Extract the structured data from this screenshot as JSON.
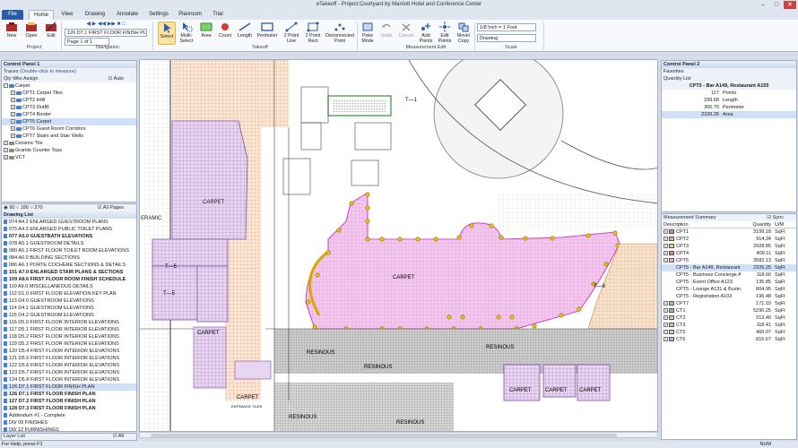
{
  "window": {
    "title": "eTakeoff - Project:Courtyard by Marriott Hotel and Conference Center",
    "minimize": "–",
    "maximize": "□",
    "close": "✕"
  },
  "tabs": [
    "File",
    "Home",
    "View",
    "Drawing",
    "Annotate",
    "Settings",
    "Planroom",
    "Trial"
  ],
  "ribbon": {
    "project_buttons": [
      "New",
      "Open",
      "Edit"
    ],
    "nav_combo": "126 D7.1 FIRST FLOOR FINISH PLAN",
    "page_combo": "Page 1 of 1",
    "takeoff_buttons": [
      "Select",
      "Multi-Select",
      "Area",
      "Count",
      "Length",
      "Perimeter",
      "2 Point Line",
      "2 Point Rect",
      "Disconnected Point"
    ],
    "edit_buttons": [
      "Poke Mode",
      "Undo",
      "Cancel",
      "Add Points",
      "Edit Points",
      "Move/ Copy"
    ],
    "scale_value": "1/8 Inch = 1 Foot",
    "scale_type": "Drawing",
    "group_labels": [
      "Project",
      "Navigation",
      "Takeoff",
      "Measurement Edit",
      "Scale"
    ]
  },
  "left_panel": {
    "title": "Control Panel 1",
    "traces_label": "Traces",
    "traces_hint": "(Double-click to measure)",
    "qty_tab": "Qty Wks Assign",
    "auto_label": "Auto",
    "tree": [
      {
        "label": "Carpet",
        "level": 0,
        "type": "folder",
        "expanded": true
      },
      {
        "label": "CPT1 Carpet Tiles",
        "level": 1,
        "type": "sub"
      },
      {
        "label": "CPT2 Infill",
        "level": 1,
        "type": "sub"
      },
      {
        "label": "CPT3 Outfill",
        "level": 1,
        "type": "sub"
      },
      {
        "label": "CPT4 Border",
        "level": 1,
        "type": "sub"
      },
      {
        "label": "CPT5 Carpet",
        "level": 1,
        "type": "sub",
        "selected": true
      },
      {
        "label": "CPT6 Guest Room Corridors",
        "level": 1,
        "type": "sub"
      },
      {
        "label": "CPT7 Stairs and Stair Wells",
        "level": 1,
        "type": "sub"
      },
      {
        "label": "Ceramic Tile",
        "level": 0,
        "type": "folder-grey"
      },
      {
        "label": "Granite Counter Tops",
        "level": 0,
        "type": "folder-grey"
      },
      {
        "label": "VCT",
        "level": 0,
        "type": "folder-grey"
      }
    ],
    "zoom_options": [
      "90",
      "180",
      "270"
    ],
    "all_pages": "All Pages",
    "drawing_list_title": "Drawing List",
    "drawings": [
      {
        "label": "074 A4.2 ENLARGED GUESTROOM PLANS"
      },
      {
        "label": "075 A4.3 ENLARGED PUBLIC TOILET PLANS"
      },
      {
        "label": "077 A5.0 GUESTBATH ELEVATIONS",
        "bold": true
      },
      {
        "label": "078 A5.1 GUESTROOM DETAILS"
      },
      {
        "label": "080 A5.3 FIRST FLOOR TOILET ROOM ELEVATIONS"
      },
      {
        "label": "084 A6.0 BUILDING SECTIONS"
      },
      {
        "label": "086 A6.1 PORTE COCHERE SECTIONS & DETAILS"
      },
      {
        "label": "101 A7.0 ENLARGED STAIR PLANS & SECTIONS",
        "bold": true
      },
      {
        "label": "109 A8.6 FIRST FLOOR ROOM FINISH SCHEDULE",
        "bold": true
      },
      {
        "label": "110 A9.0 MISCELLANEOUS DETAILS"
      },
      {
        "label": "112 D1.0 FIRST FLOOR ELEVATION KEY PLAN"
      },
      {
        "label": "113 D4.0 GUESTROOM ELEVATIONS"
      },
      {
        "label": "114 D4.1 GUESTROOM ELEVATIONS"
      },
      {
        "label": "115 D4.2 GUESTROOM ELEVATIONS"
      },
      {
        "label": "116 D5.0 FIRST FLOOR INTERIOR ELEVATIONS"
      },
      {
        "label": "117 D5.1 FIRST FLOOR INTERIOR ELEVATIONS"
      },
      {
        "label": "118 D5.2 FIRST FLOOR INTERIOR ELEVATIONS"
      },
      {
        "label": "119 D5.3 FIRST FLOOR INTERIOR ELEVATIONS"
      },
      {
        "label": "120 D5.4 FIRST FLOOR INTERIOR ELEVATIONS"
      },
      {
        "label": "121 D5.5 FIRST FLOOR INTERIOR ELEVATIONS"
      },
      {
        "label": "122 D5.6 FIRST FLOOR INTERIOR ELEVATIONS"
      },
      {
        "label": "123 D5.7 FIRST FLOOR INTERIOR ELEVATIONS"
      },
      {
        "label": "124 D5.8 FIRST FLOOR INTERIOR ELEVATIONS"
      },
      {
        "label": "126 D7.1 FIRST FLOOR FINISH PLAN",
        "selected": true
      },
      {
        "label": "126 D7.1 FIRST FLOOR FINISH PLAN",
        "bold": true
      },
      {
        "label": "127 D7.2 FIRST FLOOR FINISH PLAN",
        "bold": true
      },
      {
        "label": "128 D7.3 FIRST FLOOR FINISH PLAN",
        "bold": true
      },
      {
        "label": "Addendum #1 - Complete"
      },
      {
        "label": "D0/ 09 FINISHES"
      },
      {
        "label": "D0/ 12 FURNISHINGS"
      }
    ],
    "layer_list_title": "Layer List",
    "layer_all": "All"
  },
  "right_panel": {
    "title": "Control Panel 2",
    "favorites_title": "Favorites",
    "quantity_list_title": "Quantity List",
    "selected_item": "CPT5 - Bar A149, Restaurant A155",
    "quantities": [
      {
        "value": "117",
        "label": "Points"
      },
      {
        "value": "299.68",
        "label": "Length"
      },
      {
        "value": "300.70",
        "label": "Perimeter"
      },
      {
        "value": "2326.25",
        "label": "Area",
        "selected": true
      }
    ],
    "summary_title": "Measurement Summary",
    "sync_label": "Sync",
    "summary_headers": [
      "Description",
      "Quantity",
      "U/M"
    ],
    "summary": [
      {
        "desc": "CPT1",
        "qty": "3199.18",
        "um": "SqFt",
        "color": "#b28ad1",
        "level": 0
      },
      {
        "desc": "CPT2",
        "qty": "914.34",
        "um": "SqFt",
        "color": "#f0a58c",
        "level": 0
      },
      {
        "desc": "CPT3",
        "qty": "2928.85",
        "um": "SqFt",
        "color": "#f5c28a",
        "level": 0
      },
      {
        "desc": "CPT4",
        "qty": "409.11",
        "um": "SqFt",
        "color": "#e08080",
        "level": 0
      },
      {
        "desc": "CPT5",
        "qty": "3582.13",
        "um": "SqFt",
        "color": "#f0a8e8",
        "level": 0
      },
      {
        "desc": "CPT5 - Bar A149, Restaurant A155",
        "qty": "2326.25",
        "um": "SqFt",
        "level": 1,
        "selected": true
      },
      {
        "desc": "CPT5 - Business Concierge A104",
        "qty": "118.60",
        "um": "SqFt",
        "level": 1
      },
      {
        "desc": "CPT5 - Event Office A123",
        "qty": "135.85",
        "um": "SqFt",
        "level": 1
      },
      {
        "desc": "CPT5 - Lounge A131 & Business",
        "qty": "804.95",
        "um": "SqFt",
        "level": 1
      },
      {
        "desc": "CPT5 - Registration A103",
        "qty": "196.48",
        "um": "SqFt",
        "level": 1
      },
      {
        "desc": "CPT7",
        "qty": "171.10",
        "um": "SqFt",
        "color": "#9ad17a",
        "level": 0
      },
      {
        "desc": "CT1",
        "qty": "5290.25",
        "um": "SqFt",
        "color": "#8ab4e0",
        "level": 0
      },
      {
        "desc": "CT2",
        "qty": "213.40",
        "um": "SqFt",
        "color": "#cfcfa0",
        "level": 0
      },
      {
        "desc": "CT3",
        "qty": "118.41",
        "um": "SqFt",
        "color": "#a0d0d0",
        "level": 0
      },
      {
        "desc": "CT5",
        "qty": "460.07",
        "um": "SqFt",
        "color": "#d0d0d0",
        "level": 0
      },
      {
        "desc": "CT6",
        "qty": "815.67",
        "um": "SqFt",
        "color": "#b0b0e8",
        "level": 0
      }
    ]
  },
  "drawing": {
    "labels": {
      "carpet_a": "CARPET",
      "carpet_b": "CARPET",
      "carpet_c": "CARPET",
      "carpet_d": "CARPET",
      "carpet_e": "CARPET",
      "carpet_f": "CARPET",
      "carpet_g": "CARPET",
      "resinous_a": "RESINOUS",
      "resinous_b": "RESINOUS",
      "resinous_c": "RESINOUS",
      "resinous_d": "RESINOUS",
      "resinous_e": "RESINOUS",
      "ceramic": "ERAMIC",
      "t1": "T—1",
      "t5a": "T—5",
      "t5b": "T—5",
      "t6": "T—6",
      "entrance": "ENTRANCE TILES"
    }
  },
  "status": {
    "help": "For Help, press F1",
    "num": "NUM"
  }
}
